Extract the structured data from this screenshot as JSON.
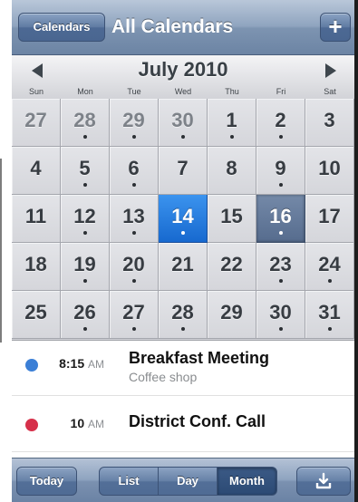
{
  "nav": {
    "calendars_label": "Calendars",
    "title": "All Calendars",
    "add_label": "+"
  },
  "month": {
    "title": "July 2010",
    "weekdays": [
      "Sun",
      "Mon",
      "Tue",
      "Wed",
      "Thu",
      "Fri",
      "Sat"
    ],
    "weeks": [
      [
        {
          "d": "27",
          "other": true,
          "dot": false
        },
        {
          "d": "28",
          "other": true,
          "dot": true
        },
        {
          "d": "29",
          "other": true,
          "dot": true
        },
        {
          "d": "30",
          "other": true,
          "dot": true
        },
        {
          "d": "1",
          "other": false,
          "dot": true
        },
        {
          "d": "2",
          "other": false,
          "dot": true
        },
        {
          "d": "3",
          "other": false,
          "dot": false
        }
      ],
      [
        {
          "d": "4",
          "other": false,
          "dot": false
        },
        {
          "d": "5",
          "other": false,
          "dot": true
        },
        {
          "d": "6",
          "other": false,
          "dot": true
        },
        {
          "d": "7",
          "other": false,
          "dot": false
        },
        {
          "d": "8",
          "other": false,
          "dot": false
        },
        {
          "d": "9",
          "other": false,
          "dot": true
        },
        {
          "d": "10",
          "other": false,
          "dot": false
        }
      ],
      [
        {
          "d": "11",
          "other": false,
          "dot": false
        },
        {
          "d": "12",
          "other": false,
          "dot": true
        },
        {
          "d": "13",
          "other": false,
          "dot": true
        },
        {
          "d": "14",
          "other": false,
          "dot": true,
          "state": "selected"
        },
        {
          "d": "15",
          "other": false,
          "dot": false
        },
        {
          "d": "16",
          "other": false,
          "dot": true,
          "state": "today"
        },
        {
          "d": "17",
          "other": false,
          "dot": false
        }
      ],
      [
        {
          "d": "18",
          "other": false,
          "dot": false
        },
        {
          "d": "19",
          "other": false,
          "dot": true
        },
        {
          "d": "20",
          "other": false,
          "dot": true
        },
        {
          "d": "21",
          "other": false,
          "dot": false
        },
        {
          "d": "22",
          "other": false,
          "dot": false
        },
        {
          "d": "23",
          "other": false,
          "dot": true
        },
        {
          "d": "24",
          "other": false,
          "dot": true
        }
      ],
      [
        {
          "d": "25",
          "other": false,
          "dot": false
        },
        {
          "d": "26",
          "other": false,
          "dot": true
        },
        {
          "d": "27",
          "other": false,
          "dot": true
        },
        {
          "d": "28",
          "other": false,
          "dot": true
        },
        {
          "d": "29",
          "other": false,
          "dot": false
        },
        {
          "d": "30",
          "other": false,
          "dot": true
        },
        {
          "d": "31",
          "other": false,
          "dot": true
        }
      ]
    ]
  },
  "events": [
    {
      "time": "8:15",
      "ampm": "AM",
      "title": "Breakfast Meeting",
      "location": "Coffee shop",
      "color": "#3b7fd6"
    },
    {
      "time": "10",
      "ampm": "AM",
      "title": "District Conf. Call",
      "location": "",
      "color": "#d6304a"
    }
  ],
  "toolbar": {
    "today_label": "Today",
    "view_list_label": "List",
    "view_day_label": "Day",
    "view_month_label": "Month",
    "selected_view": "Month",
    "export_icon": "tray-download-icon"
  },
  "colors": {
    "selected_day": "#1e78e0",
    "today_day": "#5f7596",
    "bar_blue": "#7d94b1"
  }
}
